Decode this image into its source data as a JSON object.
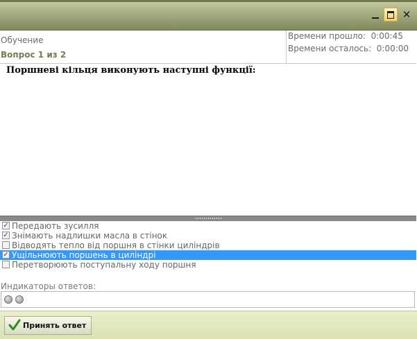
{
  "window": {
    "close_symbol": "✕"
  },
  "info": {
    "mode": "Обучение",
    "question_counter": "Вопрос  1  из  2",
    "elapsed": "Времени прошло:  0:00:45",
    "remaining": "Времени осталось:  0:00:00"
  },
  "question": {
    "text": "Поршневі  кільця виконують наступні функції:"
  },
  "answers": [
    {
      "label": "Передають зусилля",
      "checked": true,
      "selected": false
    },
    {
      "label": "Знімають надлишки масла в стінок",
      "checked": true,
      "selected": false
    },
    {
      "label": "Відводять тепло від поршня в стінки циліндрів",
      "checked": false,
      "selected": false
    },
    {
      "label": "Ущільнюють поршень в циліндрі",
      "checked": true,
      "selected": true
    },
    {
      "label": "Перетворюють поступальну ходу поршня",
      "checked": false,
      "selected": false
    }
  ],
  "indicators": {
    "label": "Индикаторы ответов:",
    "count": 2
  },
  "footer": {
    "accept_label": "Принять ответ"
  },
  "colors": {
    "selection": "#3399ff",
    "titlebar": "#8f9a68",
    "accent_text": "#777a55"
  }
}
